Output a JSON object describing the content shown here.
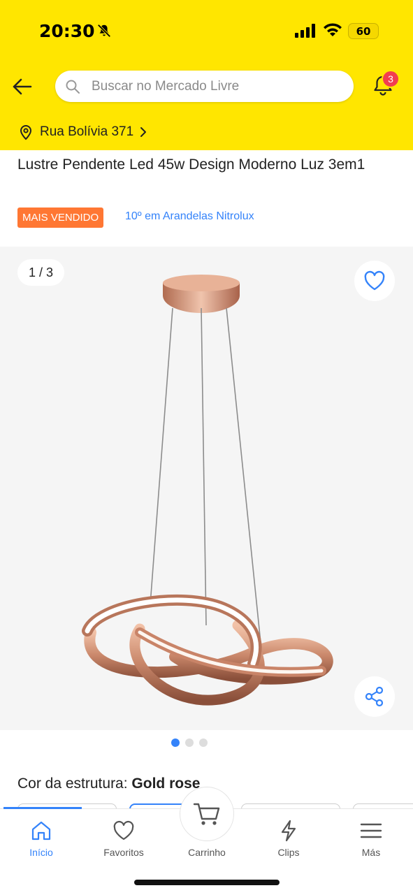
{
  "status_bar": {
    "time": "20:30",
    "battery": "60"
  },
  "header": {
    "search_placeholder": "Buscar no Mercado Livre",
    "notification_count": "3",
    "location": "Rua Bolívia 371"
  },
  "product": {
    "title": "Lustre Pendente Led 45w Design Moderno Luz 3em1",
    "badge": "MAIS VENDIDO",
    "ranking": "10º em Arandelas Nitrolux",
    "gallery_counter": "1 / 3",
    "color_label": "Cor da estrutura: ",
    "color_value": "Gold rose"
  },
  "tabs": [
    {
      "label": "Início",
      "icon": "home-icon",
      "active": true
    },
    {
      "label": "Favoritos",
      "icon": "heart-icon",
      "active": false
    },
    {
      "label": "Carrinho",
      "icon": "cart-icon",
      "active": false
    },
    {
      "label": "Clips",
      "icon": "lightning-icon",
      "active": false
    },
    {
      "label": "Más",
      "icon": "menu-icon",
      "active": false
    }
  ],
  "colors": {
    "header_yellow": "#FFE600",
    "accent_blue": "#3483FA",
    "badge_orange": "#FF7733",
    "notification_red": "#F23D4F"
  }
}
